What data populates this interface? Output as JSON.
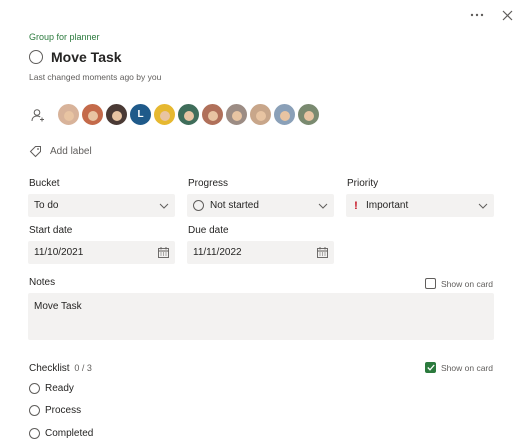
{
  "header": {
    "group": "Group for planner",
    "title": "Move Task",
    "last_changed": "Last changed moments ago by you"
  },
  "assignees": [
    {
      "name": "assignee-1",
      "bg": "#d8b39a"
    },
    {
      "name": "assignee-2",
      "bg": "#c46a4a"
    },
    {
      "name": "assignee-3",
      "bg": "#4a3a35"
    },
    {
      "name": "assignee-4",
      "bg": "#1f5a8a",
      "initial": "L"
    },
    {
      "name": "assignee-5",
      "bg": "#e6b830"
    },
    {
      "name": "assignee-6",
      "bg": "#3f6d5a"
    },
    {
      "name": "assignee-7",
      "bg": "#b0705a"
    },
    {
      "name": "assignee-8",
      "bg": "#9c8c84"
    },
    {
      "name": "assignee-9",
      "bg": "#c8a68a"
    },
    {
      "name": "assignee-10",
      "bg": "#8aa0b8"
    },
    {
      "name": "assignee-11",
      "bg": "#7a8a70"
    }
  ],
  "labels": {
    "add_label": "Add label"
  },
  "bucket": {
    "label": "Bucket",
    "value": "To do"
  },
  "progress": {
    "label": "Progress",
    "value": "Not started"
  },
  "priority": {
    "label": "Priority",
    "value": "Important",
    "color": "#c50f1f"
  },
  "start_date": {
    "label": "Start date",
    "value": "11/10/2021"
  },
  "due_date": {
    "label": "Due date",
    "value": "11/11/2022"
  },
  "notes": {
    "label": "Notes",
    "value": "Move Task",
    "show_on_card": "Show on card"
  },
  "checklist": {
    "label": "Checklist",
    "count": "0 / 3",
    "show_on_card": "Show on card",
    "items": [
      "Ready",
      "Process",
      "Completed"
    ]
  },
  "colors": {
    "accent": "#2b7a3d",
    "field_bg": "#f3f2f1"
  }
}
